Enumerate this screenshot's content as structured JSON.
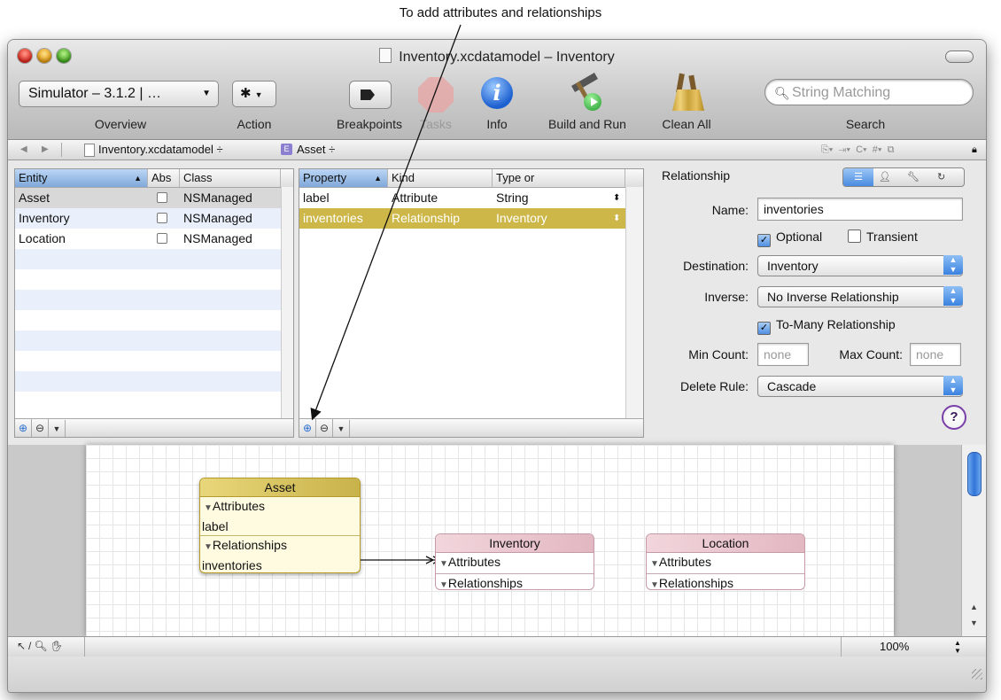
{
  "caption": "To add attributes and relationships",
  "window": {
    "title": "Inventory.xcdatamodel – Inventory"
  },
  "toolbar": {
    "overview_value": "Simulator – 3.1.2 | …",
    "overview_label": "Overview",
    "action_label": "Action",
    "breakpoints_label": "Breakpoints",
    "tasks_label": "Tasks",
    "info_label": "Info",
    "build_run_label": "Build and Run",
    "clean_all_label": "Clean All",
    "search_placeholder": "String Matching",
    "search_label": "Search"
  },
  "navbar": {
    "file": "Inventory.xcdatamodel ÷",
    "entity_badge": "E",
    "entity": "Asset ÷"
  },
  "entity_table": {
    "headers": [
      "Entity",
      "Abs",
      "Class"
    ],
    "rows": [
      {
        "name": "Asset",
        "class": "NSManaged"
      },
      {
        "name": "Inventory",
        "class": "NSManaged"
      },
      {
        "name": "Location",
        "class": "NSManaged"
      }
    ]
  },
  "property_table": {
    "headers": [
      "Property",
      "Kind",
      "Type or"
    ],
    "rows": [
      {
        "name": "label",
        "kind": "Attribute",
        "type": "String"
      },
      {
        "name": "inventories",
        "kind": "Relationship",
        "type": "Inventory"
      }
    ]
  },
  "inspector": {
    "section": "Relationship",
    "name_label": "Name:",
    "name_value": "inventories",
    "optional_label": "Optional",
    "transient_label": "Transient",
    "destination_label": "Destination:",
    "destination_value": "Inventory",
    "inverse_label": "Inverse:",
    "inverse_value": "No Inverse Relationship",
    "tomany_label": "To-Many Relationship",
    "min_label": "Min Count:",
    "min_placeholder": "none",
    "max_label": "Max Count:",
    "max_placeholder": "none",
    "delete_rule_label": "Delete Rule:",
    "delete_rule_value": "Cascade",
    "help": "?"
  },
  "diagram": {
    "asset": {
      "title": "Asset",
      "attributes": "Attributes",
      "attr1": "label",
      "relationships": "Relationships",
      "rel1": "inventories"
    },
    "inventory": {
      "title": "Inventory",
      "attributes": "Attributes",
      "relationships": "Relationships"
    },
    "location": {
      "title": "Location",
      "attributes": "Attributes",
      "relationships": "Relationships"
    }
  },
  "status": {
    "zoom": "100%"
  }
}
